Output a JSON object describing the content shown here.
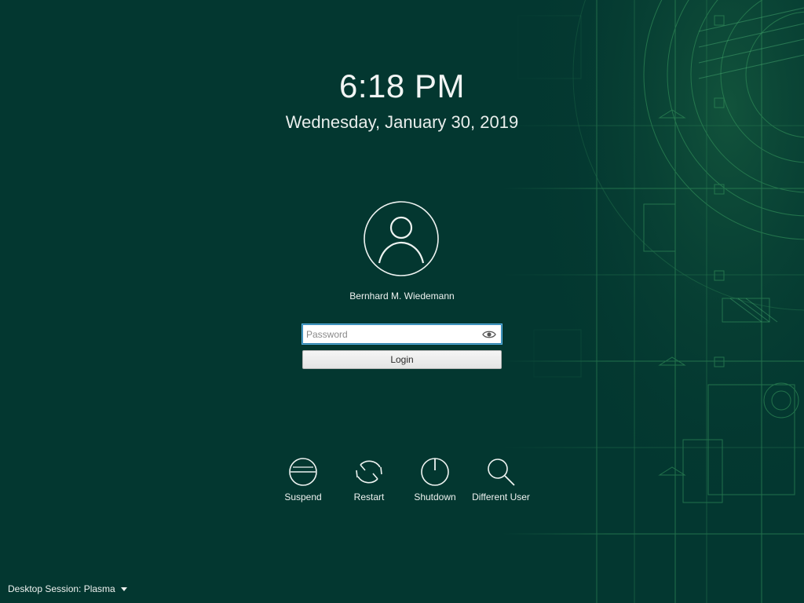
{
  "clock": {
    "time": "6:18 PM",
    "date": "Wednesday, January 30, 2019"
  },
  "user": {
    "name": "Bernhard M. Wiedemann",
    "avatar_icon": "user-avatar-icon"
  },
  "password": {
    "value": "",
    "placeholder": "Password",
    "reveal_icon": "eye-icon"
  },
  "login": {
    "label": "Login"
  },
  "actions": [
    {
      "label": "Suspend",
      "icon": "suspend-icon"
    },
    {
      "label": "Restart",
      "icon": "restart-icon"
    },
    {
      "label": "Shutdown",
      "icon": "shutdown-icon"
    },
    {
      "label": "Different User",
      "icon": "search-icon"
    }
  ],
  "session": {
    "label": "Desktop Session: Plasma",
    "icon": "caret-down-icon"
  },
  "colors": {
    "background": "#033730",
    "accent": "#57b3e4",
    "art": "#3fa068"
  }
}
